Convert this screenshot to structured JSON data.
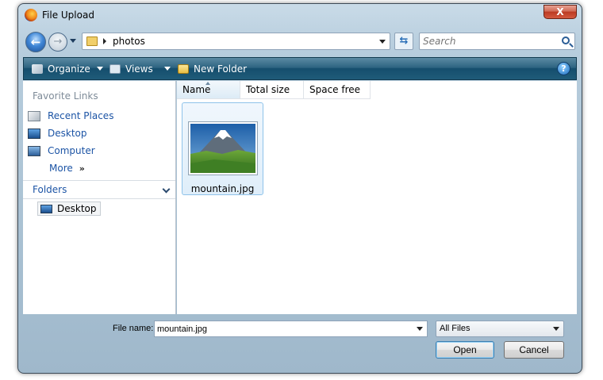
{
  "window": {
    "title": "File Upload",
    "close_label": "X"
  },
  "nav": {
    "back_glyph": "←",
    "forward_glyph": "→",
    "refresh_glyph": "⇆"
  },
  "address": {
    "path": [
      "photos"
    ]
  },
  "search": {
    "placeholder": "Search"
  },
  "toolbar": {
    "organize_label": "Organize",
    "views_label": "Views",
    "new_folder_label": "New Folder",
    "help_glyph": "?"
  },
  "sidebar": {
    "favorites_title": "Favorite Links",
    "links": [
      {
        "label": "Recent Places",
        "icon": "recent-places-icon"
      },
      {
        "label": "Desktop",
        "icon": "desktop-icon"
      },
      {
        "label": "Computer",
        "icon": "computer-icon"
      },
      {
        "label": "More",
        "icon": "more-chevrons-icon",
        "suffix": "»"
      }
    ],
    "folders_title": "Folders",
    "tree": [
      {
        "label": "Desktop",
        "icon": "desktop-icon"
      }
    ]
  },
  "file_list": {
    "columns": [
      "Name",
      "Total size",
      "Space free"
    ],
    "sorted_column": "Name",
    "files": [
      {
        "name": "mountain.jpg",
        "thumbnail": "mountain-thumbnail",
        "selected": true
      }
    ]
  },
  "footer": {
    "file_name_label": "File name:",
    "file_name_value": "mountain.jpg",
    "file_type_value": "All Files",
    "open_label": "Open",
    "cancel_label": "Cancel"
  },
  "colors": {
    "toolbar": "#1f5b79",
    "link": "#1c54a5",
    "selection": "#dfeefa"
  }
}
